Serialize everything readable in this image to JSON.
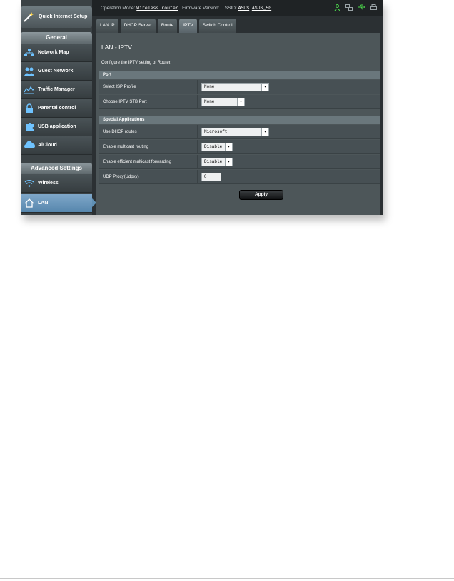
{
  "status_bar": {
    "op_mode_label": "Operation Mode:",
    "op_mode_value": "Wireless router",
    "firmware_label": "Firmware Version:",
    "ssid_label": "SSID:",
    "ssid_1": "ASUS",
    "ssid_2": "ASUS_5G",
    "icons": [
      "user-icon",
      "network-icon",
      "usb-icon",
      "printer-icon"
    ]
  },
  "sidebar": {
    "quick_setup": "Quick Internet Setup",
    "general_header": "General",
    "general_items": [
      {
        "label": "Network Map",
        "icon": "network-map-icon"
      },
      {
        "label": "Guest Network",
        "icon": "guest-network-icon"
      },
      {
        "label": "Traffic Manager",
        "icon": "traffic-manager-icon"
      },
      {
        "label": "Parental control",
        "icon": "lock-icon"
      },
      {
        "label": "USB application",
        "icon": "puzzle-icon"
      },
      {
        "label": "AiCloud",
        "icon": "cloud-icon"
      }
    ],
    "advanced_header": "Advanced Settings",
    "advanced_items": [
      {
        "label": "Wireless",
        "icon": "wifi-icon"
      },
      {
        "label": "LAN",
        "icon": "home-icon",
        "active": true
      }
    ]
  },
  "tabs": [
    "LAN IP",
    "DHCP Server",
    "Route",
    "IPTV",
    "Switch Control"
  ],
  "active_tab": "IPTV",
  "page": {
    "title": "LAN - IPTV",
    "description": "Configure the IPTV setting of Router."
  },
  "port_section": {
    "header": "Port",
    "isp_profile_label": "Select ISP Profile",
    "isp_profile_value": "None",
    "stb_port_label": "Choose IPTV STB Port",
    "stb_port_value": "None"
  },
  "special_section": {
    "header": "Special Applications",
    "dhcp_routes_label": "Use DHCP routes",
    "dhcp_routes_value": "Microsoft",
    "multicast_label": "Enable multicast routing",
    "multicast_value": "Disable",
    "efficient_multicast_label": "Enable efficient multicast forwarding",
    "efficient_multicast_value": "Disable",
    "udpxy_label": "UDP Proxy(Udpxy)",
    "udpxy_value": "0"
  },
  "apply_label": "Apply",
  "colors": {
    "accent": "#5787ad",
    "panel": "#4d5659",
    "status_green": "#4cd94c"
  }
}
